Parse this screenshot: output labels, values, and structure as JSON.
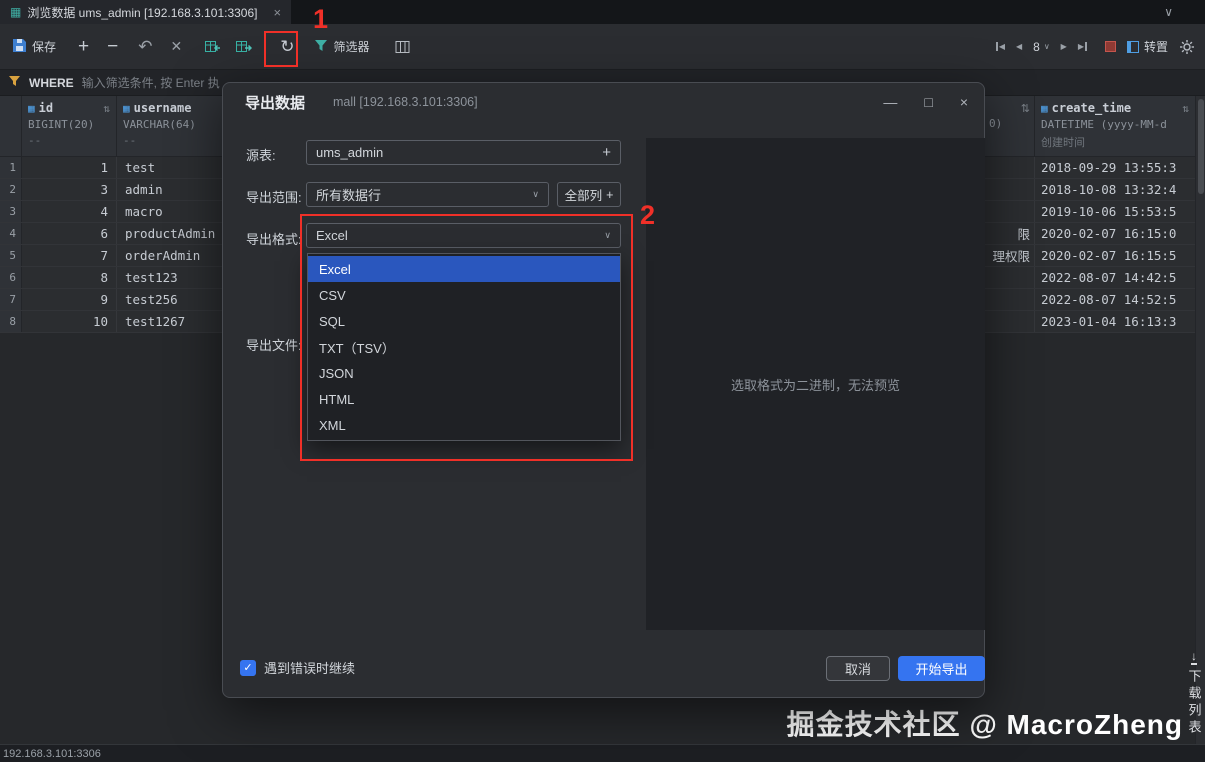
{
  "colors": {
    "accent_blue": "#3574f0",
    "selection_blue": "#2a57be",
    "annotation_red": "#f03028",
    "icon_teal": "#38b2a5"
  },
  "tab_bar": {
    "title": "浏览数据 ums_admin [192.168.3.101:3306]"
  },
  "toolbar": {
    "save": "保存",
    "filter": "筛选器",
    "page_size": "8",
    "transpose": "转置"
  },
  "where_bar": {
    "keyword": "WHERE",
    "placeholder": "输入筛选条件, 按 Enter 执"
  },
  "grid": {
    "columns": [
      {
        "name": "id",
        "type": "BIGINT(20)",
        "comment": "--"
      },
      {
        "name": "username",
        "type": "VARCHAR(64)",
        "comment": "--"
      }
    ],
    "rows": [
      {
        "num": "1",
        "id": "1",
        "username": "test"
      },
      {
        "num": "2",
        "id": "3",
        "username": "admin"
      },
      {
        "num": "3",
        "id": "4",
        "username": "macro"
      },
      {
        "num": "4",
        "id": "6",
        "username": "productAdmin"
      },
      {
        "num": "5",
        "id": "7",
        "username": "orderAdmin"
      },
      {
        "num": "6",
        "id": "8",
        "username": "test123"
      },
      {
        "num": "7",
        "id": "9",
        "username": "test256"
      },
      {
        "num": "8",
        "id": "10",
        "username": "test1267"
      }
    ]
  },
  "right_grid": {
    "clipped_type_fragment": "0)",
    "fragments": {
      "row4": "限",
      "row5": "理权限"
    },
    "column": {
      "name": "create_time",
      "type": "DATETIME (yyyy-MM-d",
      "comment": "创建时间"
    },
    "values": [
      "2018-09-29 13:55:3",
      "2018-10-08 13:32:4",
      "2019-10-06 15:53:5",
      "2020-02-07 16:15:0",
      "2020-02-07 16:15:5",
      "2022-08-07 14:42:5",
      "2022-08-07 14:52:5",
      "2023-01-04 16:13:3"
    ]
  },
  "dialog": {
    "title": "导出数据",
    "subtitle": "mall [192.168.3.101:3306]",
    "source_label": "源表:",
    "source_value": "ums_admin",
    "range_label": "导出范围:",
    "range_value": "所有数据行",
    "all_columns_button": "全部列",
    "format_label": "导出格式:",
    "format_value": "Excel",
    "file_label": "导出文件:",
    "format_options": [
      "Excel",
      "CSV",
      "SQL",
      "TXT（TSV）",
      "JSON",
      "HTML",
      "XML"
    ],
    "preview_placeholder": "选取格式为二进制，无法预览",
    "continue_on_error_label": "遇到错误时继续",
    "cancel_button": "取消",
    "start_button": "开始导出"
  },
  "annotations": {
    "step1": "1",
    "step2": "2"
  },
  "watermark": "掘金技术社区 @ MacroZheng",
  "download_list_label": "下载列表",
  "status_bar": {
    "host": "192.168.3.101:3306"
  }
}
